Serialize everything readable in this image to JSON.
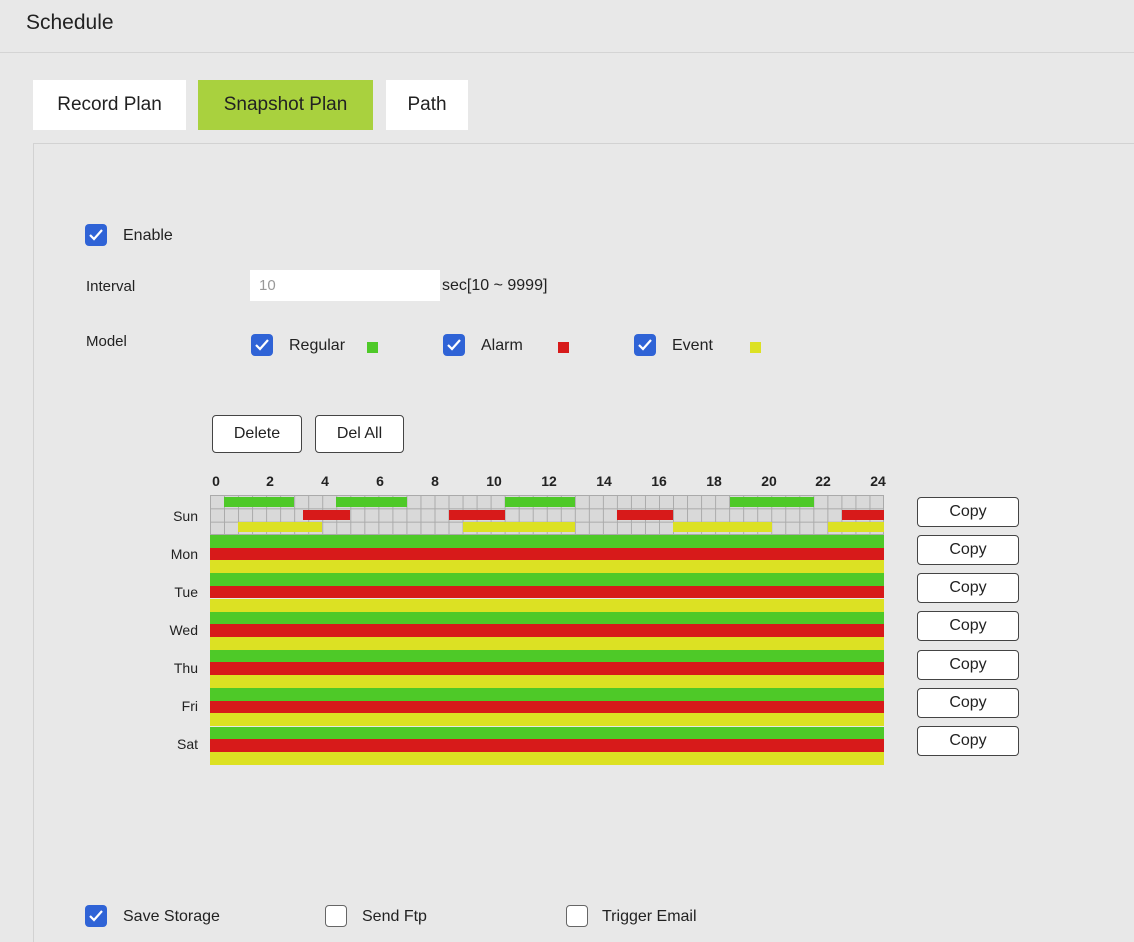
{
  "header": {
    "title": "Schedule"
  },
  "tabs": [
    {
      "label": "Record Plan",
      "active": false
    },
    {
      "label": "Snapshot Plan",
      "active": true
    },
    {
      "label": "Path",
      "active": false
    }
  ],
  "enable": {
    "label": "Enable",
    "checked": true
  },
  "interval": {
    "label": "Interval",
    "value": "10",
    "unit": "sec[10 ~ 9999]"
  },
  "model": {
    "label": "Model",
    "items": [
      {
        "label": "Regular",
        "checked": true,
        "color": "#4ec928"
      },
      {
        "label": "Alarm",
        "checked": true,
        "color": "#d71a1a"
      },
      {
        "label": "Event",
        "checked": true,
        "color": "#dce123"
      }
    ]
  },
  "actions": {
    "delete": "Delete",
    "del_all": "Del All"
  },
  "schedule": {
    "hours": [
      "0",
      "2",
      "4",
      "6",
      "8",
      "10",
      "12",
      "14",
      "16",
      "18",
      "20",
      "22",
      "24"
    ],
    "days": [
      "Sun",
      "Mon",
      "Tue",
      "Wed",
      "Thu",
      "Fri",
      "Sat"
    ],
    "copy_label": "Copy",
    "sun_segments": {
      "regular": [
        [
          0.5,
          3
        ],
        [
          4.5,
          7
        ],
        [
          10.5,
          13
        ],
        [
          18.5,
          21.5
        ]
      ],
      "alarm": [
        [
          3.3,
          5
        ],
        [
          8.5,
          10.5
        ],
        [
          14.5,
          16.5
        ],
        [
          22.5,
          24
        ]
      ],
      "event": [
        [
          1,
          4
        ],
        [
          9,
          13
        ],
        [
          16.5,
          20
        ],
        [
          22,
          24
        ]
      ]
    },
    "full_days": [
      "Mon",
      "Tue",
      "Wed",
      "Thu",
      "Fri",
      "Sat"
    ]
  },
  "options": [
    {
      "label": "Save Storage",
      "checked": true
    },
    {
      "label": "Send Ftp",
      "checked": false
    },
    {
      "label": "Trigger Email",
      "checked": false
    }
  ]
}
